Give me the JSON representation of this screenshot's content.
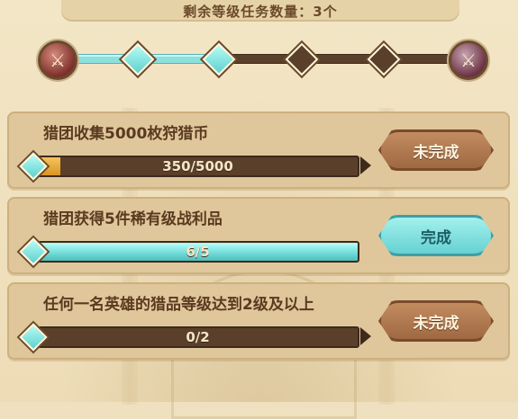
{
  "header": {
    "remaining_text": "剩余等级任务数量：3个"
  },
  "progress_track": {
    "nodes": [
      {
        "state": "done"
      },
      {
        "state": "done"
      },
      {
        "state": "todo"
      },
      {
        "state": "todo"
      }
    ],
    "left_emblem_icon": "crossed-swords-emblem-icon",
    "right_emblem_icon": "crossed-swords-emblem-icon",
    "colors": {
      "filled": "#8ee0dc",
      "empty": "#5a3f2a"
    }
  },
  "tasks": [
    {
      "title": "猎团收集5000枚狩猎币",
      "progress_text": "350/5000",
      "progress_fraction": 0.07,
      "button_label": "未完成",
      "status": "incomplete"
    },
    {
      "title": "猎团获得5件稀有级战利品",
      "progress_text": "6/5",
      "progress_fraction": 1.0,
      "button_label": "完成",
      "status": "complete"
    },
    {
      "title": "任何一名英雄的猎品等级达到2级及以上",
      "progress_text": "0/2",
      "progress_fraction": 0,
      "button_label": "未完成",
      "status": "incomplete"
    }
  ]
}
